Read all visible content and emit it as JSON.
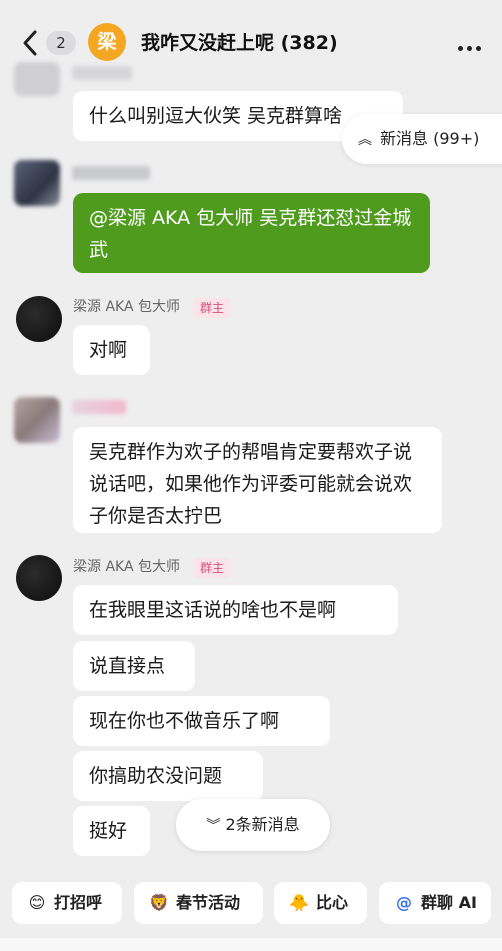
{
  "header": {
    "unread_count": "2",
    "group_avatar_char": "梁",
    "group_title": "我咋又没赶上呢 (382)"
  },
  "floating_new": {
    "label": "新消息 (99+)"
  },
  "messages": [
    {
      "text": "什么叫别逗大伙笑 吴克群算啥"
    },
    {
      "text": "@梁源 AKA 包大师 吴克群还怼过金城武"
    },
    {
      "sender": "梁源 AKA 包大师",
      "badge": "群主",
      "text": "对啊"
    },
    {
      "text": "吴克群作为欢子的帮唱肯定要帮欢子说说话吧，如果他作为评委可能就会说欢子你是否太拧巴"
    },
    {
      "sender": "梁源 AKA 包大师",
      "badge": "群主"
    },
    {
      "text": "在我眼里这话说的啥也不是啊"
    },
    {
      "text": "说直接点"
    },
    {
      "text": "现在你也不做音乐了啊"
    },
    {
      "text": "你搞助农没问题"
    },
    {
      "text": "挺好"
    }
  ],
  "bottom_new": {
    "label": "2条新消息"
  },
  "quick_actions": [
    {
      "icon": "wave-emoji-icon",
      "label": "打招呼"
    },
    {
      "icon": "lion-dance-icon",
      "label": "春节活动"
    },
    {
      "icon": "heart-chick-icon",
      "label": "比心"
    },
    {
      "icon": "at-icon",
      "label": "群聊 AI"
    }
  ],
  "colors": {
    "accent_green": "#4f9b1d",
    "badge_pink": "#d4507a",
    "avatar_orange": "#f5a623"
  }
}
